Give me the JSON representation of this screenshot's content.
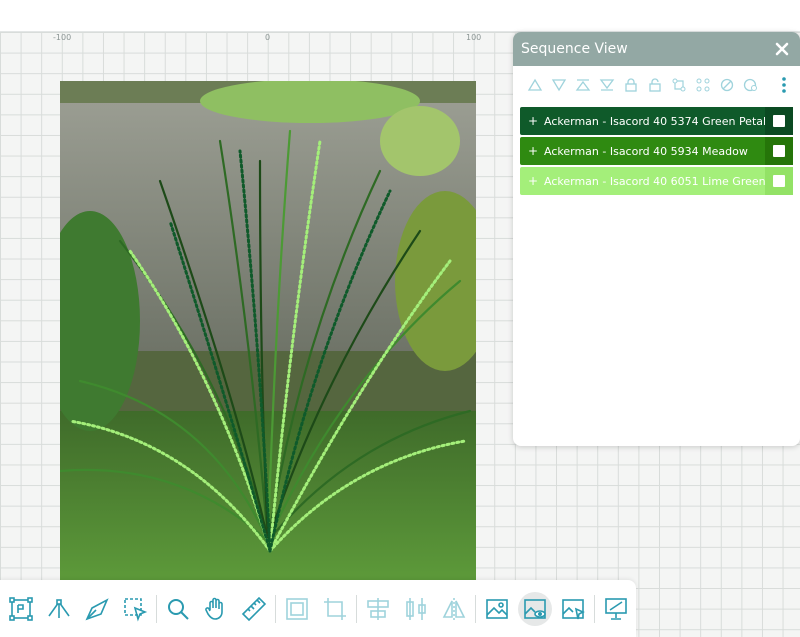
{
  "ruler": {
    "ticks": [
      "-100",
      "0",
      "100"
    ]
  },
  "panel": {
    "title": "Sequence View",
    "close_icon": "close-icon",
    "tools": [
      "triangle-up-icon",
      "triangle-down-icon",
      "triangle-top-bar-icon",
      "triangle-bottom-bar-icon",
      "lock-icon",
      "unlock-icon",
      "split-icon",
      "link-icon",
      "hide-icon",
      "visibility-icon",
      "more-vertical-icon"
    ],
    "threads": [
      {
        "plus": "+",
        "label": "Ackerman - Isacord 40 5374 Green Petal",
        "color": "#0f5a2a"
      },
      {
        "plus": "+",
        "label": "Ackerman - Isacord 40 5934 Meadow",
        "color": "#2f8a11"
      },
      {
        "plus": "+",
        "label": "Ackerman - Isacord 40 6051 Lime Green",
        "color": "#a4ef7a"
      }
    ]
  },
  "toolbar": {
    "tools": [
      "select-points-icon",
      "node-edit-icon",
      "pen-icon",
      "select-area-icon",
      "zoom-icon",
      "hand-icon",
      "ruler-icon",
      "fit-design-icon",
      "crop-icon",
      "align-icon",
      "distribute-icon",
      "mirror-icon",
      "image-icon",
      "image-preview-icon",
      "image-select-icon",
      "presentation-icon"
    ],
    "active": "image-preview-icon"
  },
  "colors": {
    "accent": "#2a9ab0",
    "panel_header": "#93a8a4"
  }
}
